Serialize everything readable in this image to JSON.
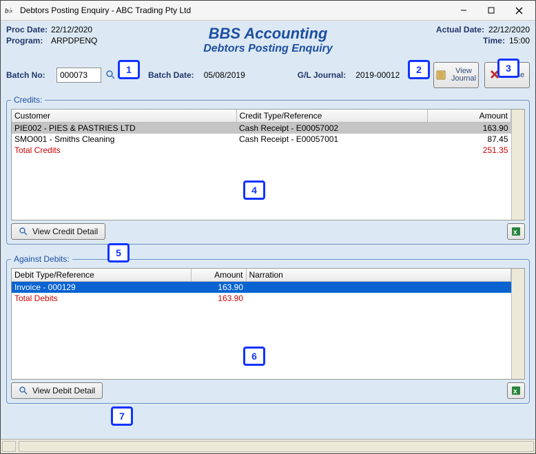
{
  "window": {
    "title": "Debtors Posting Enquiry - ABC Trading Pty Ltd"
  },
  "header": {
    "proc_date_label": "Proc Date:",
    "proc_date": "22/12/2020",
    "actual_date_label": "Actual Date:",
    "actual_date": "22/12/2020",
    "program_label": "Program:",
    "program": "ARPDPENQ",
    "time_label": "Time:",
    "time": "15:00",
    "app_title_1": "BBS Accounting",
    "app_title_2": "Debtors Posting Enquiry"
  },
  "batch": {
    "no_label": "Batch No:",
    "no_value": "000073",
    "date_label": "Batch Date:",
    "date_value": "05/08/2019",
    "gl_label": "G/L Journal:",
    "gl_value": "2019-00012"
  },
  "buttons": {
    "view_journal": "View\nJournal",
    "close": "Close",
    "view_credit_detail": "View Credit Detail",
    "view_debit_detail": "View Debit Detail"
  },
  "credits": {
    "legend": "Credits:",
    "cols": {
      "customer": "Customer",
      "type": "Credit Type/Reference",
      "amount": "Amount"
    },
    "rows": [
      {
        "customer": "PIE002 -  PIES & PASTRIES LTD",
        "type": "Cash Receipt - E00057002",
        "amount": "163.90",
        "selected": true
      },
      {
        "customer": "SMO001 -  Smiths Cleaning",
        "type": "Cash Receipt - E00057001",
        "amount": "87.45",
        "selected": false
      }
    ],
    "total_label": "Total Credits",
    "total_amount": "251.35"
  },
  "debits": {
    "legend": "Against Debits:",
    "cols": {
      "type": "Debit Type/Reference",
      "amount": "Amount",
      "narration": "Narration"
    },
    "rows": [
      {
        "type": "Invoice - 000129",
        "amount": "163.90",
        "narration": "",
        "selected": true
      }
    ],
    "total_label": "Total Debits",
    "total_amount": "163.90"
  },
  "callouts": [
    "1",
    "2",
    "3",
    "4",
    "5",
    "6",
    "7"
  ]
}
